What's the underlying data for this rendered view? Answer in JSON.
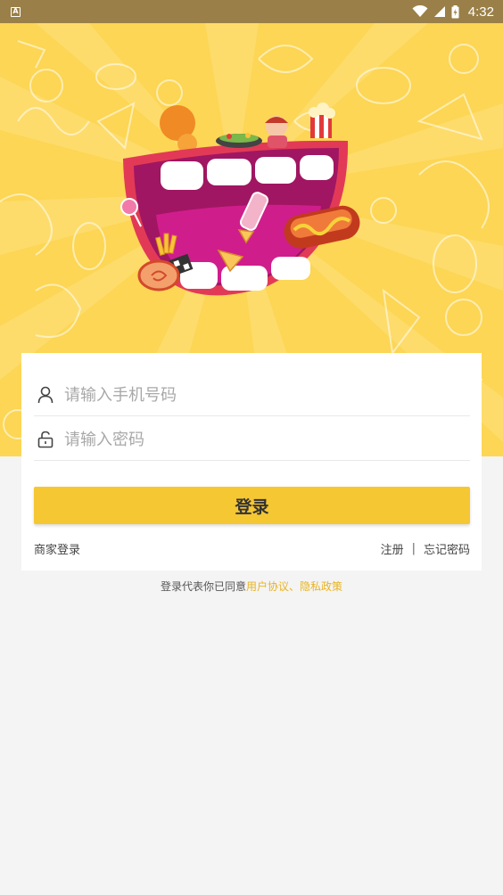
{
  "status_bar": {
    "notification_icon_label": "A",
    "time": "4:32"
  },
  "form": {
    "phone_placeholder": "请输入手机号码",
    "password_placeholder": "请输入密码",
    "login_label": "登录",
    "merchant_login_label": "商家登录",
    "register_label": "注册",
    "separator": "|",
    "forgot_password_label": "忘记密码"
  },
  "agreement": {
    "prefix": "登录代表你已同意",
    "user_agreement": "用户协议",
    "joiner": "、",
    "privacy_policy": "隐私政策"
  },
  "colors": {
    "accent": "#f5c733",
    "hero_background": "#fcd654",
    "link": "#e8b423",
    "status_bar": "#9a8048",
    "page_background": "#f4f4f4"
  }
}
